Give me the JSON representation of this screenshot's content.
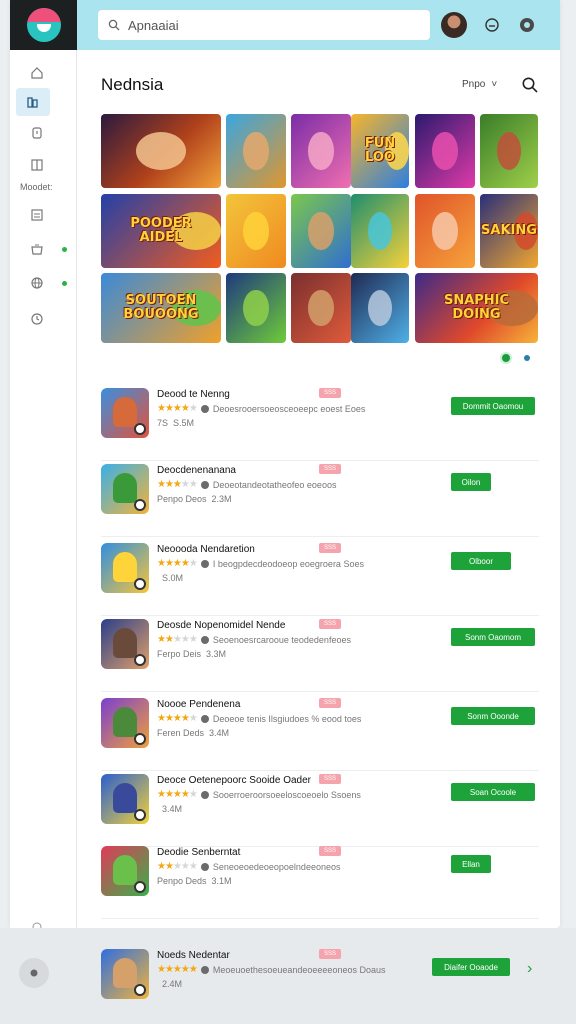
{
  "search": {
    "placeholder": "Apnaaiai"
  },
  "sidebar": {
    "label": "Moodet:"
  },
  "page": {
    "title": "Nednsia",
    "sort_label": "Pnpo",
    "sort_chevron": "˅"
  },
  "tiles": [
    {
      "text": ""
    },
    {
      "text": ""
    },
    {
      "text": ""
    },
    {
      "text": "FUN\nLOO"
    },
    {
      "text": ""
    },
    {
      "text": ""
    },
    {
      "text": "POODER\nAIDEL"
    },
    {
      "text": ""
    },
    {
      "text": ""
    },
    {
      "text": ""
    },
    {
      "text": ""
    },
    {
      "text": "SAKING"
    },
    {
      "text": "SOUTOEN\nBOUOONG"
    },
    {
      "text": ""
    },
    {
      "text": ""
    },
    {
      "text": ""
    },
    {
      "text": "SNAPHIC\nDOING"
    }
  ],
  "apps": [
    {
      "name": "Deood te Nenng",
      "tag": "SSS",
      "line2": "Deoesrooersoeosceoeepc eoest Eoes",
      "line3": "S.5M",
      "line3_pre": "7S",
      "stars": 4,
      "install": "Dommit Oaomou",
      "install_small": false
    },
    {
      "name": "Deocdenenanana",
      "tag": "SSS",
      "line2": "Deoeotandeotatheofeo eoeoos",
      "line3": "2.3M",
      "line3_pre": "Penpo Deos",
      "stars": 3,
      "install": "Oilon",
      "install_small": true
    },
    {
      "name": "Neoooda Nendaretion",
      "tag": "SSS",
      "line2": "I beogpdecdeodoeop eoegroera Soes",
      "line3": "S.0M",
      "line3_pre": "",
      "stars": 4,
      "install": "Olboor",
      "install_small": false
    },
    {
      "name": "Deosde Nopenomidel Nende",
      "tag": "SSS",
      "line2": "Seoenoesrcarooue teodedenfeoes",
      "line3": "3.3M",
      "line3_pre": "Ferpo Deis",
      "stars": 2,
      "install": "Sonm Oaomom",
      "install_small": false
    },
    {
      "name": "Noooe Pendenena",
      "tag": "SSS",
      "line2": "Deoeoe tenis Ilsgiudoes % eood toes",
      "line3": "3.4M",
      "line3_pre": "Feren Deds",
      "stars": 4,
      "install": "Sonm Ooonde",
      "install_small": false
    },
    {
      "name": "Deoce Oetenepoorc Sooide Oader",
      "tag": "SSS",
      "line2": "Sooerroeroorsoeeloscoeoelo Ssoens",
      "line3": "3.4M",
      "line3_pre": "",
      "stars": 4,
      "install": "Soan Ocoole",
      "install_small": false
    },
    {
      "name": "Deodie Senberntat",
      "tag": "SSS",
      "line2": "Seneoeoedeoeopoelndeeoneos",
      "line3": "3.1M",
      "line3_pre": "Penpo Deds",
      "stars": 2,
      "install": "Ellan",
      "install_small": true
    }
  ],
  "bottom_app": {
    "name": "Noeds Nedentar",
    "tag": "SSS",
    "line2": "Meoeuoethesoeueandeoeeeeoneos Doaus",
    "line3": "2.4M",
    "stars": 5,
    "install": "Diaifer Ooaode"
  },
  "colors": {
    "accent": "#1ea33b",
    "topbar": "#a9e4ef"
  }
}
